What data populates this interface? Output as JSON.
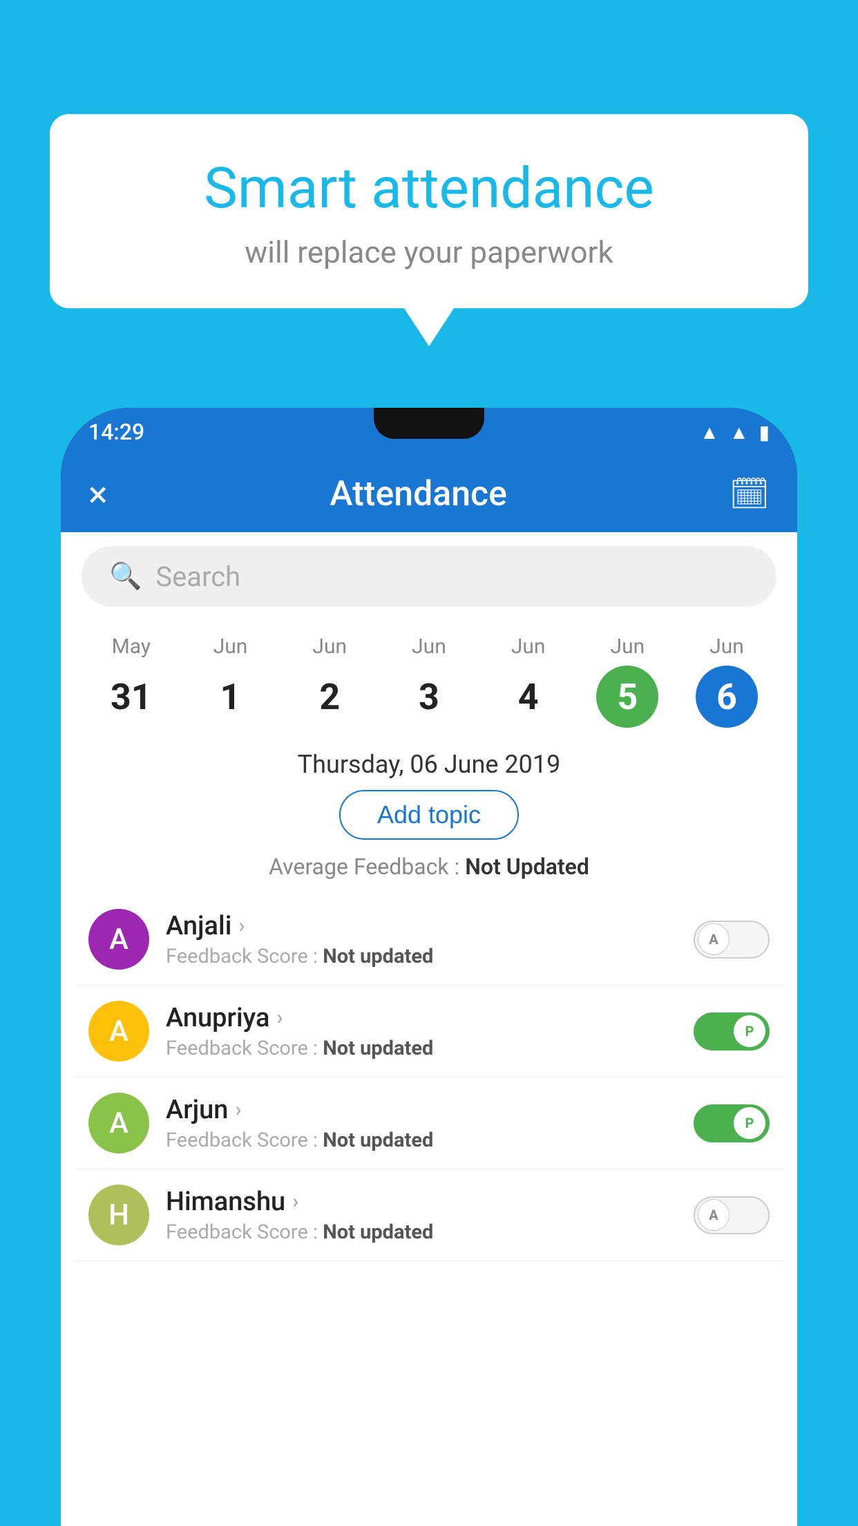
{
  "background_color": "#1ab8e8",
  "speech_bubble": {
    "title": "Smart attendance",
    "subtitle": "will replace your paperwork"
  },
  "status_bar": {
    "time": "14:29",
    "icons": [
      "wifi",
      "signal",
      "battery"
    ]
  },
  "app_bar": {
    "title": "Attendance",
    "close_label": "×",
    "calendar_icon": "📅"
  },
  "search": {
    "placeholder": "Search"
  },
  "calendar": {
    "days": [
      {
        "month": "May",
        "date": "31"
      },
      {
        "month": "Jun",
        "date": "1"
      },
      {
        "month": "Jun",
        "date": "2"
      },
      {
        "month": "Jun",
        "date": "3"
      },
      {
        "month": "Jun",
        "date": "4"
      },
      {
        "month": "Jun",
        "date": "5",
        "selected": "green"
      },
      {
        "month": "Jun",
        "date": "6",
        "selected": "blue"
      }
    ],
    "selected_date_label": "Thursday, 06 June 2019"
  },
  "add_topic_btn": "Add topic",
  "avg_feedback": {
    "label": "Average Feedback : ",
    "value": "Not Updated"
  },
  "students": [
    {
      "name": "Anjali",
      "initial": "A",
      "avatar_color": "purple",
      "feedback": "Feedback Score : ",
      "feedback_value": "Not updated",
      "status": "absent",
      "toggle_label": "A"
    },
    {
      "name": "Anupriya",
      "initial": "A",
      "avatar_color": "yellow",
      "feedback": "Feedback Score : ",
      "feedback_value": "Not updated",
      "status": "present",
      "toggle_label": "P"
    },
    {
      "name": "Arjun",
      "initial": "A",
      "avatar_color": "green",
      "feedback": "Feedback Score : ",
      "feedback_value": "Not updated",
      "status": "present",
      "toggle_label": "P"
    },
    {
      "name": "Himanshu",
      "initial": "H",
      "avatar_color": "olive",
      "feedback": "Feedback Score : ",
      "feedback_value": "Not updated",
      "status": "absent",
      "toggle_label": "A"
    }
  ]
}
